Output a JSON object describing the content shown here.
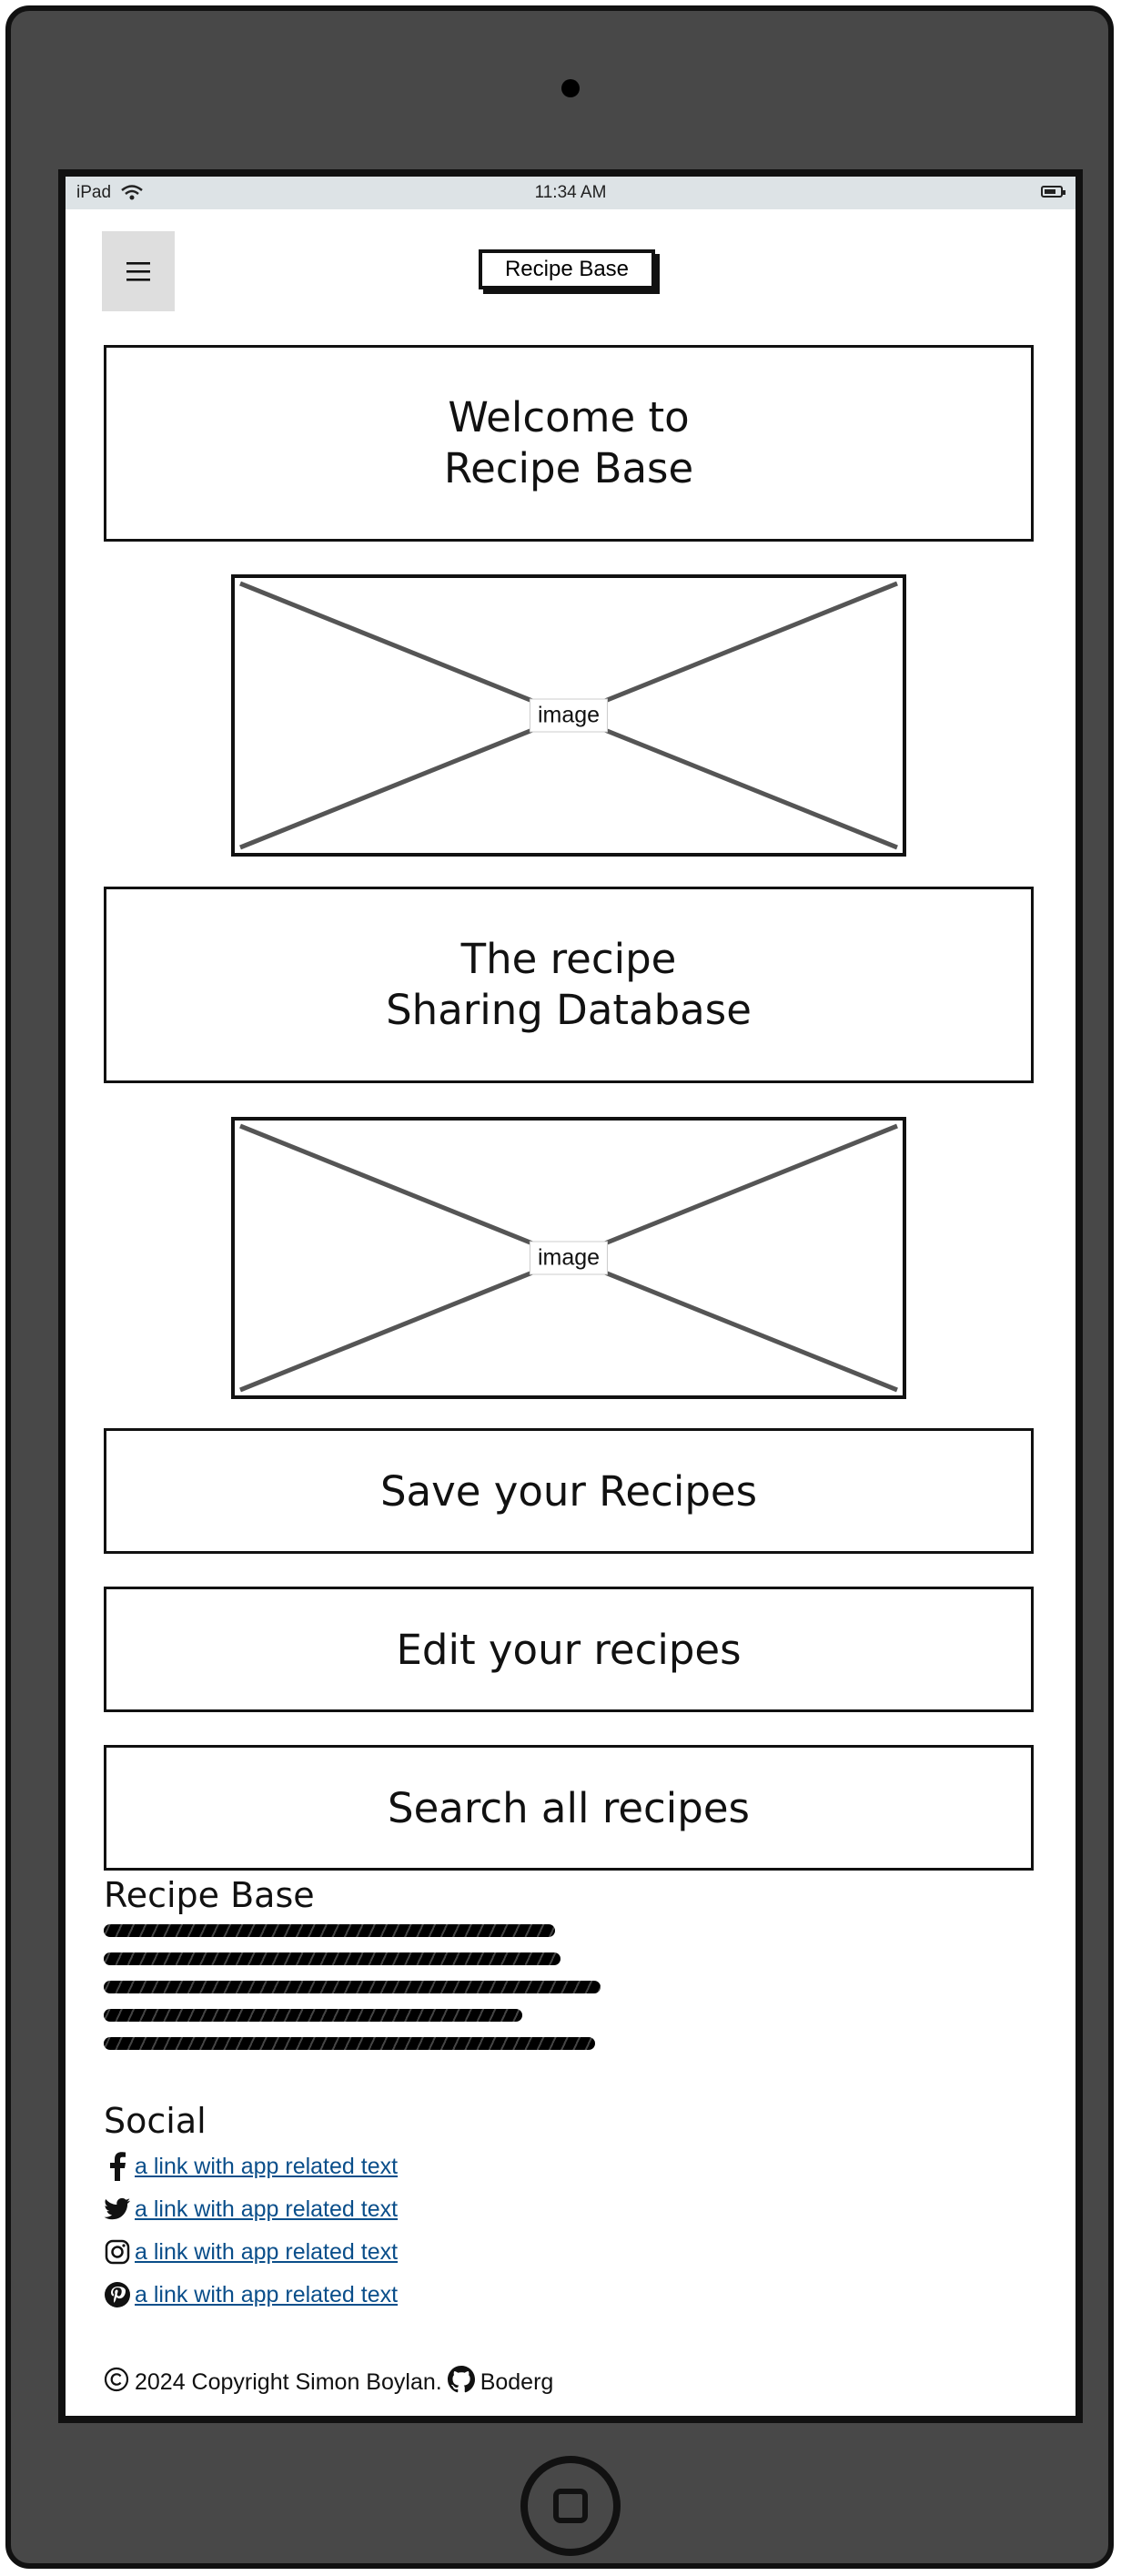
{
  "status_bar": {
    "device": "iPad",
    "time": "11:34 AM"
  },
  "header": {
    "menu_icon": "hamburger-menu-icon",
    "brand": "Recipe Base"
  },
  "hero": {
    "welcome": "Welcome to\nRecipe Base",
    "image_label": "image"
  },
  "tagline": {
    "text": "The recipe\nSharing Database",
    "image_label": "image"
  },
  "features": [
    {
      "label": "Save your Recipes"
    },
    {
      "label": "Edit your recipes"
    },
    {
      "label": "Search all recipes"
    }
  ],
  "footer": {
    "about_title": "Recipe Base",
    "social_title": "Social",
    "social_links": [
      {
        "icon": "facebook-icon",
        "text": "a link with app related text"
      },
      {
        "icon": "twitter-icon",
        "text": "a link with app related text"
      },
      {
        "icon": "instagram-icon",
        "text": "a link with app related text"
      },
      {
        "icon": "pinterest-icon",
        "text": "a link with app related text"
      }
    ],
    "copyright": "2024 Copyright Simon Boylan.",
    "github_user": "Boderg"
  },
  "colors": {
    "device_body": "#484848",
    "status_bar": "#dde3e6",
    "link": "#0a4e8a",
    "menu_button": "#dedede"
  }
}
